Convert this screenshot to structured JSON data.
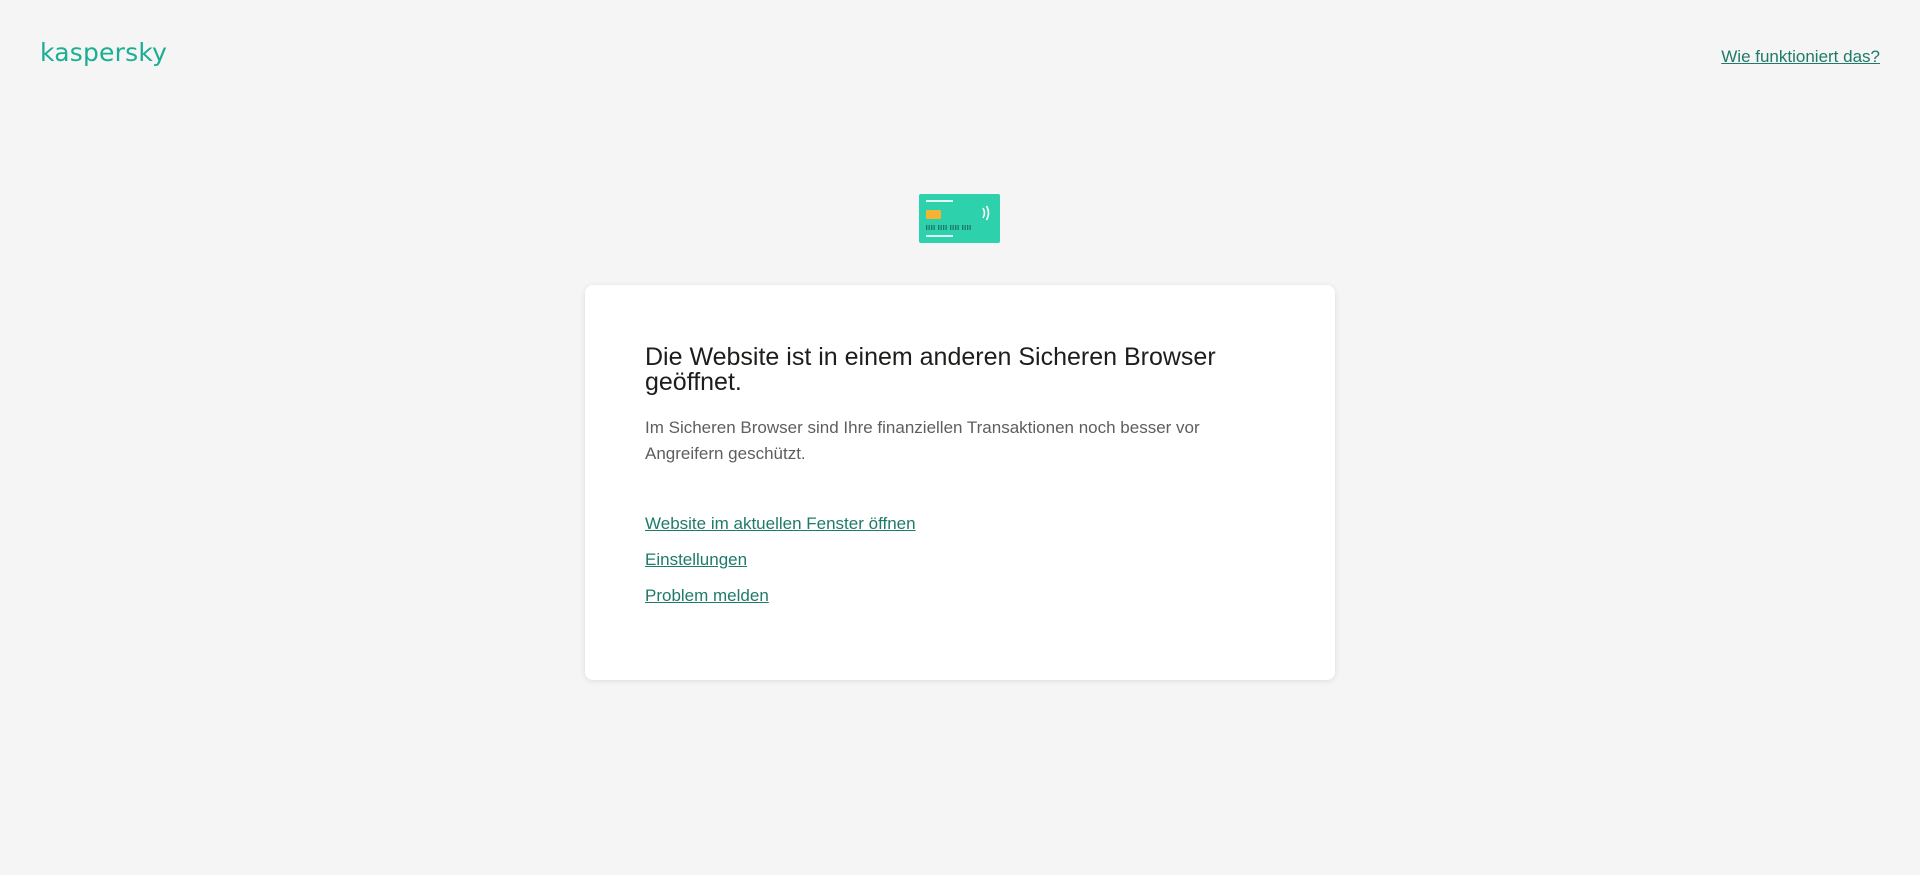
{
  "header": {
    "logo_text": "kaspersky",
    "help_link": "Wie funktioniert das?"
  },
  "icon": {
    "name": "bank-card-icon",
    "card_color": "#2dd1ac",
    "chip_color": "#f5b335",
    "number_groups": [
      "IIII",
      "IIII",
      "IIII",
      "IIII"
    ]
  },
  "dialog": {
    "title": "Die Website ist in einem anderen Sicheren Browser geöffnet.",
    "description": "Im Sicheren Browser sind Ihre finanziellen Transaktionen noch besser vor Angreifern geschützt.",
    "links": [
      "Website im aktuellen Fenster öffnen",
      "Einstellungen",
      "Problem melden"
    ]
  },
  "colors": {
    "background": "#f5f5f5",
    "brand": "#1aae93",
    "link": "#1f7a6a"
  }
}
